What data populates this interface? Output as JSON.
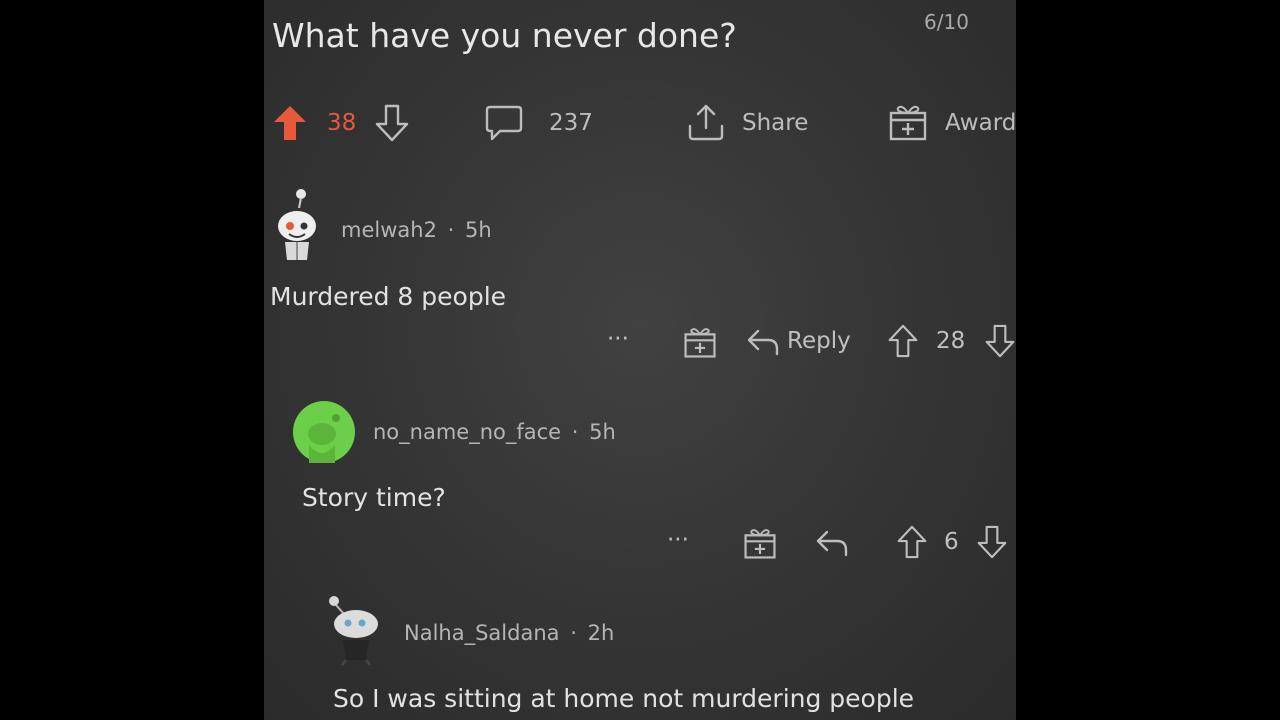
{
  "post": {
    "title": "What have you never done?",
    "page_counter": "6/10",
    "upvotes": "38",
    "comments_count": "237",
    "share_label": "Share",
    "award_label": "Award"
  },
  "comments": [
    {
      "username": "melwah2",
      "separator": "·",
      "age": "5h",
      "body": "Murdered 8 people",
      "more": "···",
      "reply_label": "Reply",
      "score": "28"
    },
    {
      "username": "no_name_no_face",
      "separator": "·",
      "age": "5h",
      "body": "Story time?",
      "more": "···",
      "score": "6"
    },
    {
      "username": "Nalha_Saldana",
      "separator": "·",
      "age": "2h",
      "body": "So I was sitting at home not murdering people"
    }
  ],
  "colors": {
    "upvote_active": "#e8593b",
    "background": "#383838",
    "avatar_green": "#6ccf4a"
  },
  "icons": [
    "upvote-arrow-icon",
    "downvote-arrow-icon",
    "comment-bubble-icon",
    "share-icon",
    "award-gift-icon",
    "reply-arrow-icon",
    "more-dots-icon",
    "snoo-avatar-icon"
  ]
}
